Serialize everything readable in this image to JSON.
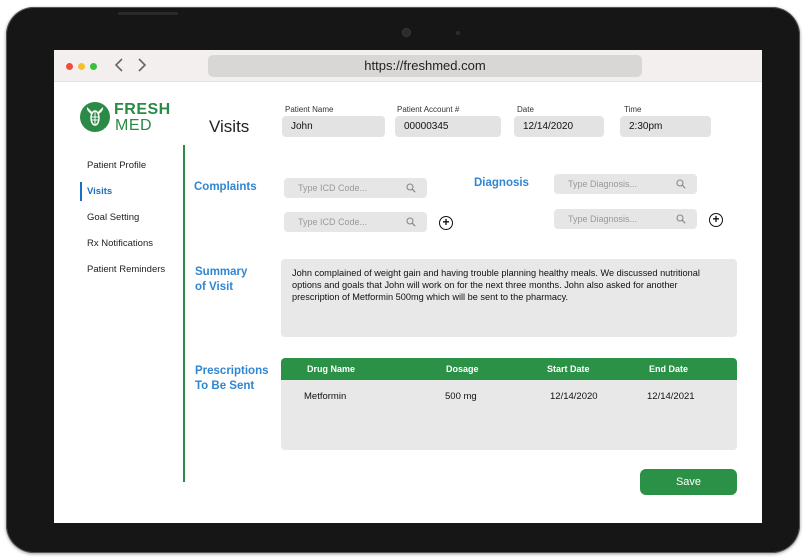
{
  "browser": {
    "url": "https://freshmed.com",
    "back_icon": "chevron-left-icon",
    "forward_icon": "chevron-right-icon"
  },
  "logo": {
    "line1": "FRESH",
    "line2": "MED"
  },
  "page_title": "Visits",
  "header": {
    "patient_name_label": "Patient Name",
    "patient_name": "John",
    "account_label": "Patient Account #",
    "account": "00000345",
    "date_label": "Date",
    "date": "12/14/2020",
    "time_label": "Time",
    "time": "2:30pm"
  },
  "sidebar": {
    "items": [
      {
        "label": "Patient Profile",
        "active": false
      },
      {
        "label": "Visits",
        "active": true
      },
      {
        "label": "Goal Setting",
        "active": false
      },
      {
        "label": "Rx Notifications",
        "active": false
      },
      {
        "label": "Patient Reminders",
        "active": false
      }
    ]
  },
  "complaints": {
    "label": "Complaints",
    "placeholder": "Type ICD Code..."
  },
  "diagnosis": {
    "label": "Diagnosis",
    "placeholder": "Type Diagnosis..."
  },
  "summary": {
    "label_line1": "Summary",
    "label_line2": "of Visit",
    "text": "John complained of weight gain and having trouble planning healthy meals. We discussed nutritional options and goals that John will work on for the next three months. John also asked for another prescription of Metformin 500mg which will be sent to the pharmacy."
  },
  "prescriptions": {
    "label_line1": "Prescriptions",
    "label_line2": "To Be Sent",
    "columns": [
      "Drug Name",
      "Dosage",
      "Start Date",
      "End Date"
    ],
    "rows": [
      [
        "Metformin",
        "500 mg",
        "12/14/2020",
        "12/14/2021"
      ]
    ]
  },
  "save_label": "Save",
  "colors": {
    "brand_green": "#2b9147",
    "accent_blue": "#2f86d2",
    "field_gray": "#e3e3e3"
  }
}
